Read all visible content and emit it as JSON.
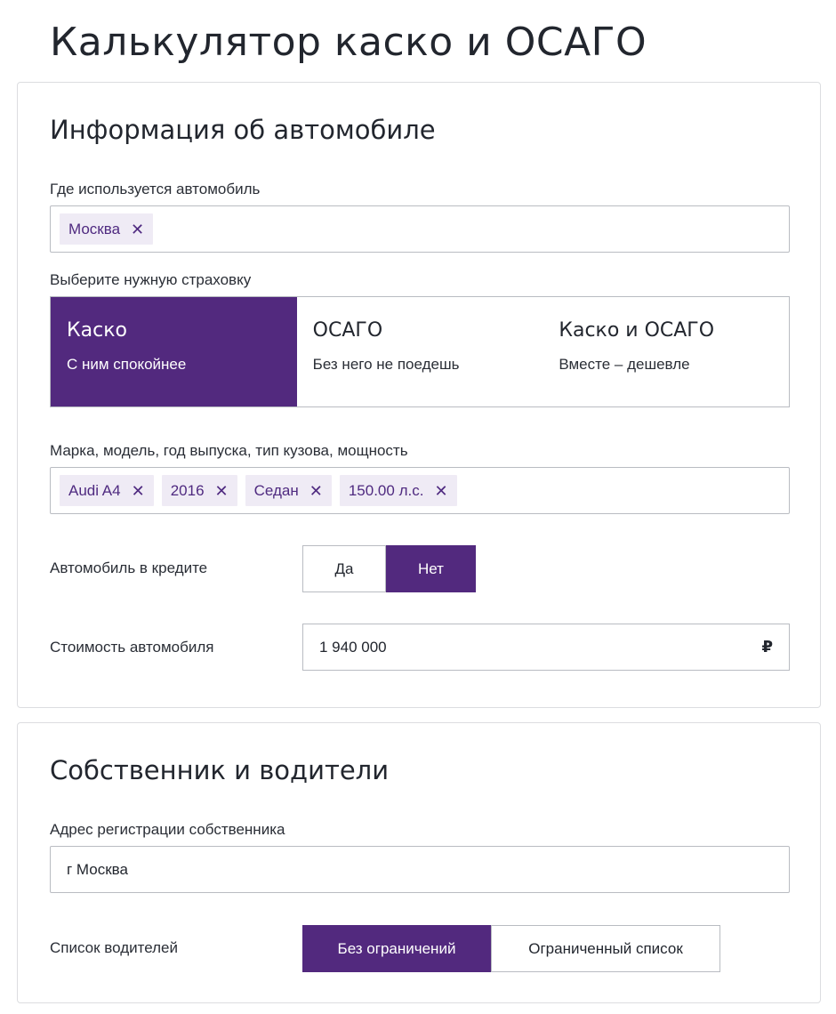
{
  "page": {
    "title": "Калькулятор каско и ОСАГО"
  },
  "car_info": {
    "title": "Информация об автомобиле",
    "location_label": "Где используется автомобиль",
    "location_tags": [
      "Москва"
    ],
    "insurance_label": "Выберите нужную страховку",
    "insurance_options": [
      {
        "name": "Каско",
        "sub": "С ним спокойнее",
        "selected": true
      },
      {
        "name": "ОСАГО",
        "sub": "Без него не поедешь",
        "selected": false
      },
      {
        "name": "Каско и ОСАГО",
        "sub": "Вместе – дешевле",
        "selected": false
      }
    ],
    "car_label": "Марка, модель, год выпуска, тип кузова, мощность",
    "car_tags": [
      "Audi A4",
      "2016",
      "Седан",
      "150.00 л.с."
    ],
    "credit_label": "Автомобиль в кредите",
    "credit_options": [
      {
        "label": "Да",
        "selected": false
      },
      {
        "label": "Нет",
        "selected": true
      }
    ],
    "price_label": "Стоимость автомобиля",
    "price_value": "1 940 000",
    "currency": "₽"
  },
  "owner": {
    "title": "Собственник и водители",
    "address_label": "Адрес регистрации собственника",
    "address_value": "г Москва",
    "drivers_label": "Список водителей",
    "drivers_options": [
      {
        "label": "Без ограничений",
        "selected": true
      },
      {
        "label": "Ограниченный список",
        "selected": false
      }
    ]
  },
  "colors": {
    "accent": "#52297e",
    "tag_bg": "#efebf5",
    "border": "#b9bcc2"
  },
  "icons": {
    "remove_tag": "close-icon",
    "currency": "ruble-icon"
  }
}
